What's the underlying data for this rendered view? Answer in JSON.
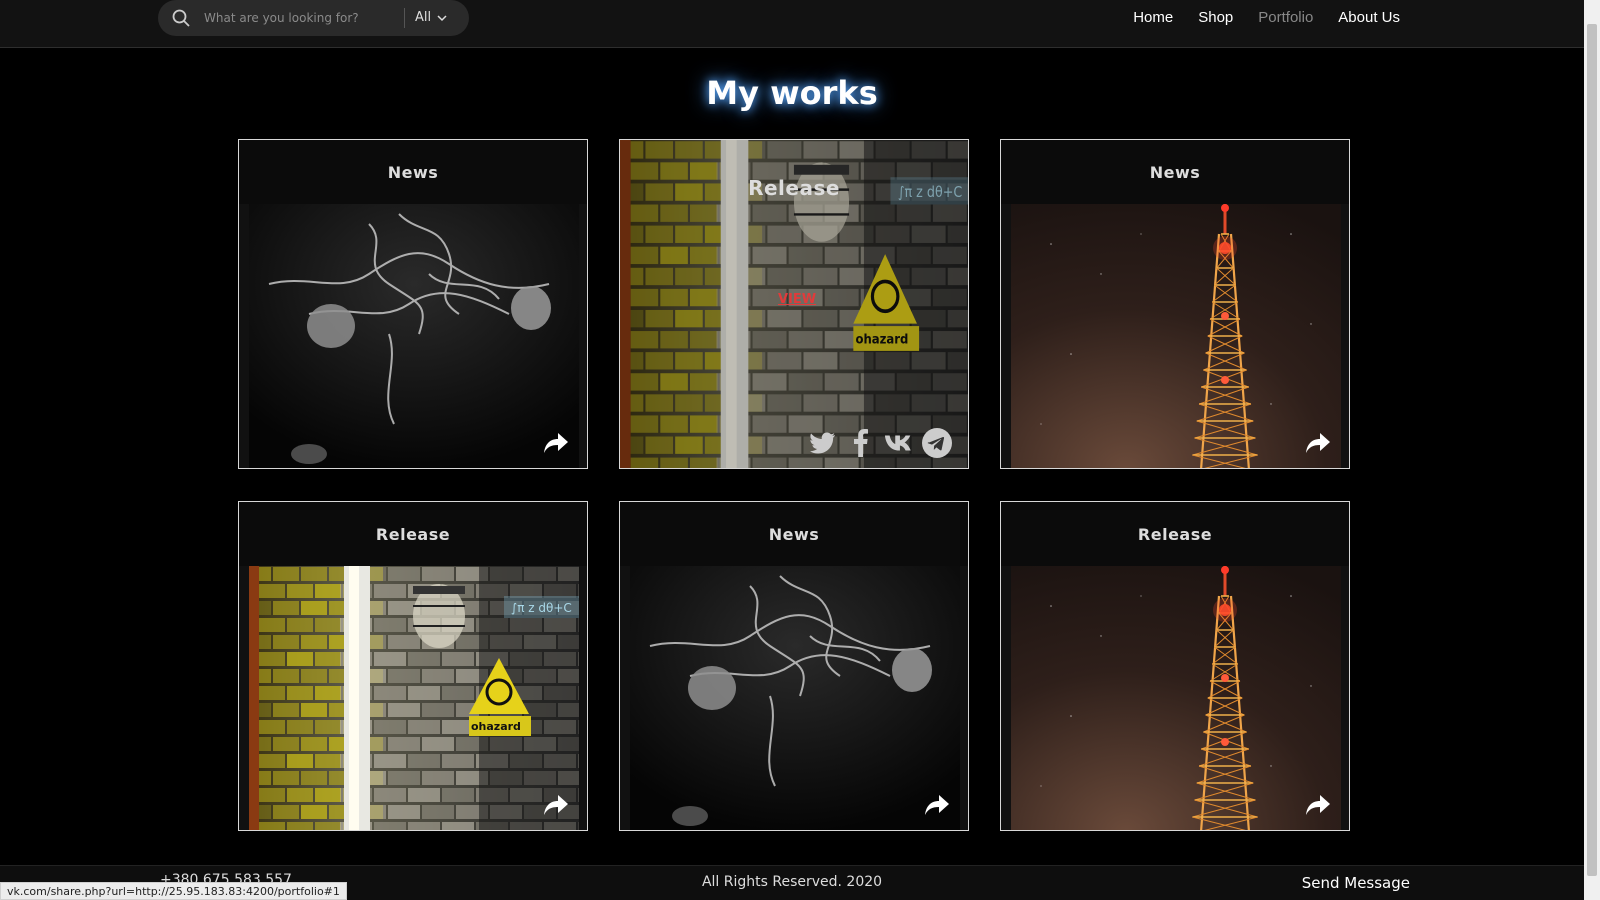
{
  "search": {
    "placeholder": "What are you looking for?",
    "filter": "All"
  },
  "nav": {
    "items": [
      "Home",
      "Shop",
      "Portfolio",
      "About Us"
    ],
    "active": "Portfolio"
  },
  "page": {
    "title": "My works"
  },
  "cards": [
    {
      "label": "News",
      "image": "smoke-bw"
    },
    {
      "label": "Release",
      "image": "biohazard-wall",
      "hover": true,
      "view": "VIEW",
      "social": [
        "twitter-icon",
        "facebook-icon",
        "vk-icon",
        "telegram-icon"
      ],
      "sign": "ohazard"
    },
    {
      "label": "News",
      "image": "radio-tower-night"
    },
    {
      "label": "Release",
      "image": "biohazard-wall",
      "sign": "ohazard"
    },
    {
      "label": "News",
      "image": "smoke-bw"
    },
    {
      "label": "Release",
      "image": "radio-tower-night"
    }
  ],
  "footer": {
    "phone": "+380 675 583 557",
    "copyright": "All Rights Reserved. 2020",
    "send": "Send Message"
  },
  "status_bar": {
    "url": "vk.com/share.php?url=http://25.95.183.83:4200/portfolio#1"
  },
  "colors": {
    "title_glow": "#5aa9ff",
    "view_link": "#e03b3b"
  }
}
